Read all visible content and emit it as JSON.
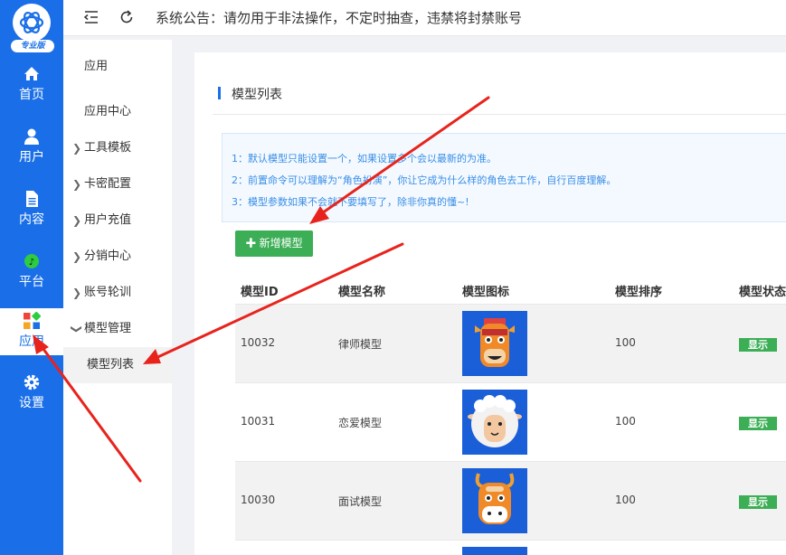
{
  "logo": {
    "badge": "专业版"
  },
  "nav": [
    {
      "label": "首页",
      "icon": "home-icon"
    },
    {
      "label": "用户",
      "icon": "user-icon"
    },
    {
      "label": "内容",
      "icon": "document-icon"
    },
    {
      "label": "平台",
      "icon": "music-icon"
    },
    {
      "label": "应用",
      "icon": "apps-icon",
      "active": true
    },
    {
      "label": "设置",
      "icon": "gear-icon"
    }
  ],
  "header": {
    "notice": "系统公告：请勿用于非法操作，不定时抽查，违禁将封禁账号"
  },
  "submenu": {
    "title": "应用",
    "items": [
      {
        "label": "应用中心"
      },
      {
        "label": "工具模板"
      },
      {
        "label": "卡密配置"
      },
      {
        "label": "用户充值"
      },
      {
        "label": "分销中心"
      },
      {
        "label": "账号轮训"
      },
      {
        "label": "模型管理"
      },
      {
        "label": "模型列表"
      }
    ]
  },
  "page": {
    "title": "模型列表",
    "tips": [
      "1：默认模型只能设置一个，如果设置多个会以最新的为准。",
      "2：前置命令可以理解为“角色扮演”，你让它成为什么样的角色去工作，自行百度理解。",
      "3：模型参数如果不会就不要填写了，除非你真的懂~!"
    ],
    "add_button": "新增模型"
  },
  "table": {
    "headers": [
      "模型ID",
      "模型名称",
      "模型图标",
      "模型排序",
      "模型状态"
    ],
    "rows": [
      {
        "id": "10032",
        "name": "律师模型",
        "sort": "100",
        "status": "显示"
      },
      {
        "id": "10031",
        "name": "恋爱模型",
        "sort": "100",
        "status": "显示"
      },
      {
        "id": "10030",
        "name": "面试模型",
        "sort": "100",
        "status": "显示"
      }
    ]
  },
  "colors": {
    "primary": "#1a6fe8",
    "success": "#3cae55",
    "annotation": "#e8231c"
  }
}
